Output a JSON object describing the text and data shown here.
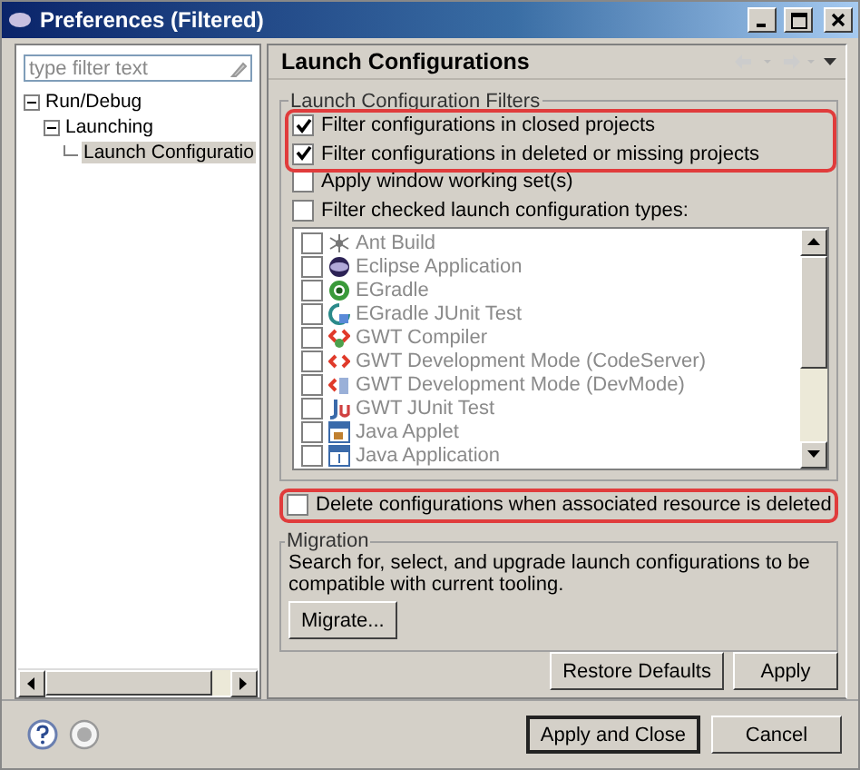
{
  "window": {
    "title": "Preferences (Filtered)"
  },
  "sidebar": {
    "filter": {
      "placeholder": "type filter text"
    },
    "tree": [
      {
        "label": "Run/Debug",
        "expanded": true,
        "selected": false,
        "children": [
          {
            "label": "Launching",
            "expanded": true,
            "selected": false,
            "children": [
              {
                "label": "Launch Configuratio",
                "selected": true
              }
            ]
          }
        ]
      }
    ]
  },
  "page": {
    "title": "Launch Configurations",
    "filters_group": {
      "title": "Launch Configuration Filters",
      "options": [
        {
          "label": "Filter configurations in closed projects",
          "checked": true,
          "highlighted": true
        },
        {
          "label": "Filter configurations in deleted or missing projects",
          "checked": true,
          "highlighted": true
        },
        {
          "label": "Apply window working set(s)",
          "checked": false,
          "highlighted": false
        },
        {
          "label": "Filter checked launch configuration types:",
          "checked": false,
          "highlighted": false
        }
      ],
      "types_disabled": true,
      "types": [
        {
          "label": "Ant Build",
          "kind": "ant",
          "checked": false
        },
        {
          "label": "Eclipse Application",
          "kind": "eclipse",
          "checked": false
        },
        {
          "label": "EGradle",
          "kind": "gradle",
          "checked": false
        },
        {
          "label": "EGradle JUnit Test",
          "kind": "gradletest",
          "checked": false
        },
        {
          "label": "GWT Compiler",
          "kind": "gwt",
          "checked": false
        },
        {
          "label": "GWT Development Mode (CodeServer)",
          "kind": "gwtserver",
          "checked": false
        },
        {
          "label": "GWT Development Mode (DevMode)",
          "kind": "gwtdev",
          "checked": false
        },
        {
          "label": "GWT JUnit Test",
          "kind": "junit",
          "checked": false
        },
        {
          "label": "Java Applet",
          "kind": "applet",
          "checked": false
        },
        {
          "label": "Java Application",
          "kind": "app",
          "checked": false
        }
      ]
    },
    "delete_option": {
      "label": "Delete configurations when associated resource is deleted",
      "checked": false,
      "highlighted": true
    },
    "migration": {
      "title": "Migration",
      "text": "Search for, select, and upgrade launch configurations to be compatible with current tooling.",
      "button": "Migrate..."
    },
    "buttons": [
      "Restore Defaults",
      "Apply"
    ]
  },
  "footer": {
    "buttons": [
      {
        "label": "Apply and Close",
        "default": true
      },
      {
        "label": "Cancel",
        "default": false
      }
    ]
  }
}
